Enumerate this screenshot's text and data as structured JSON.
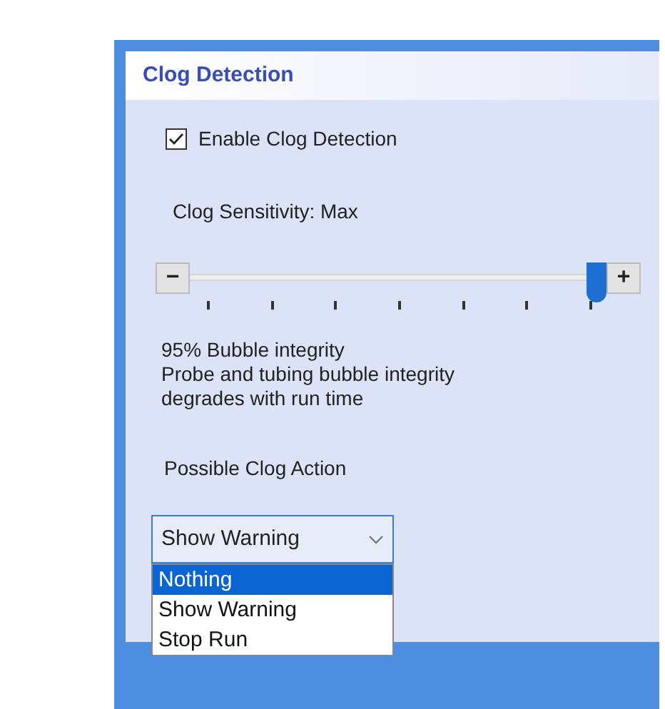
{
  "panel": {
    "title": "Clog Detection"
  },
  "enable_checkbox": {
    "label": "Enable Clog Detection",
    "checked": true
  },
  "sensitivity": {
    "label": "Clog Sensitivity: Max",
    "minus": "−",
    "plus": "+",
    "level": 1
  },
  "info_lines": [
    "95% Bubble integrity",
    "Probe and tubing bubble integrity",
    "degrades with run time"
  ],
  "clog_action": {
    "label": "Possible Clog Action",
    "value": "Show Warning",
    "expanded": true,
    "options": [
      {
        "label": "Nothing",
        "highlighted": true
      },
      {
        "label": "Show Warning",
        "highlighted": false
      },
      {
        "label": "Stop Run",
        "highlighted": false
      }
    ]
  }
}
